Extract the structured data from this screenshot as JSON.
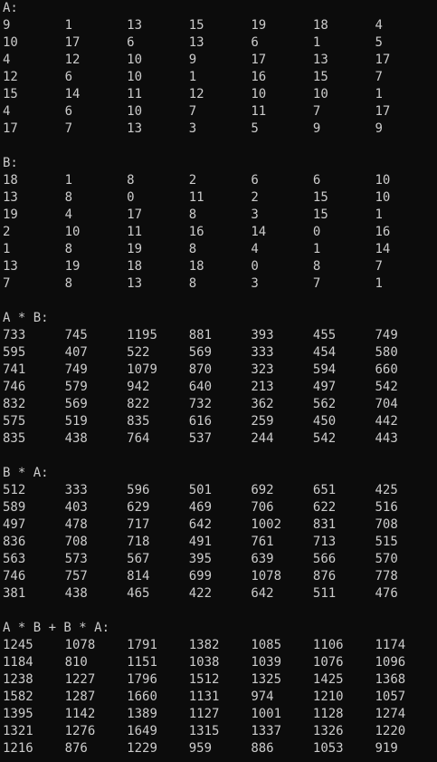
{
  "sections": [
    {
      "label": "A:",
      "rows": [
        [
          "9",
          "1",
          "13",
          "15",
          "19",
          "18",
          "4"
        ],
        [
          "10",
          "17",
          "6",
          "13",
          "6",
          "1",
          "5"
        ],
        [
          "4",
          "12",
          "10",
          "9",
          "17",
          "13",
          "17"
        ],
        [
          "12",
          "6",
          "10",
          "1",
          "16",
          "15",
          "7"
        ],
        [
          "15",
          "14",
          "11",
          "12",
          "10",
          "10",
          "1"
        ],
        [
          "4",
          "6",
          "10",
          "7",
          "11",
          "7",
          "17"
        ],
        [
          "17",
          "7",
          "13",
          "3",
          "5",
          "9",
          "9"
        ]
      ]
    },
    {
      "label": "B:",
      "rows": [
        [
          "18",
          "1",
          "8",
          "2",
          "6",
          "6",
          "10"
        ],
        [
          "13",
          "8",
          "0",
          "11",
          "2",
          "15",
          "10"
        ],
        [
          "19",
          "4",
          "17",
          "8",
          "3",
          "15",
          "1"
        ],
        [
          "2",
          "10",
          "11",
          "16",
          "14",
          "0",
          "16"
        ],
        [
          "1",
          "8",
          "19",
          "8",
          "4",
          "1",
          "14"
        ],
        [
          "13",
          "19",
          "18",
          "18",
          "0",
          "8",
          "7"
        ],
        [
          "7",
          "8",
          "13",
          "8",
          "3",
          "7",
          "1"
        ]
      ]
    },
    {
      "label": "A * B:",
      "rows": [
        [
          "733",
          "745",
          "1195",
          "881",
          "393",
          "455",
          "749"
        ],
        [
          "595",
          "407",
          "522",
          "569",
          "333",
          "454",
          "580"
        ],
        [
          "741",
          "749",
          "1079",
          "870",
          "323",
          "594",
          "660"
        ],
        [
          "746",
          "579",
          "942",
          "640",
          "213",
          "497",
          "542"
        ],
        [
          "832",
          "569",
          "822",
          "732",
          "362",
          "562",
          "704"
        ],
        [
          "575",
          "519",
          "835",
          "616",
          "259",
          "450",
          "442"
        ],
        [
          "835",
          "438",
          "764",
          "537",
          "244",
          "542",
          "443"
        ]
      ]
    },
    {
      "label": "B * A:",
      "rows": [
        [
          "512",
          "333",
          "596",
          "501",
          "692",
          "651",
          "425"
        ],
        [
          "589",
          "403",
          "629",
          "469",
          "706",
          "622",
          "516"
        ],
        [
          "497",
          "478",
          "717",
          "642",
          "1002",
          "831",
          "708"
        ],
        [
          "836",
          "708",
          "718",
          "491",
          "761",
          "713",
          "515"
        ],
        [
          "563",
          "573",
          "567",
          "395",
          "639",
          "566",
          "570"
        ],
        [
          "746",
          "757",
          "814",
          "699",
          "1078",
          "876",
          "778"
        ],
        [
          "381",
          "438",
          "465",
          "422",
          "642",
          "511",
          "476"
        ]
      ]
    },
    {
      "label": "A * B + B * A:",
      "rows": [
        [
          "1245",
          "1078",
          "1791",
          "1382",
          "1085",
          "1106",
          "1174"
        ],
        [
          "1184",
          "810",
          "1151",
          "1038",
          "1039",
          "1076",
          "1096"
        ],
        [
          "1238",
          "1227",
          "1796",
          "1512",
          "1325",
          "1425",
          "1368"
        ],
        [
          "1582",
          "1287",
          "1660",
          "1131",
          "974",
          "1210",
          "1057"
        ],
        [
          "1395",
          "1142",
          "1389",
          "1127",
          "1001",
          "1128",
          "1274"
        ],
        [
          "1321",
          "1276",
          "1649",
          "1315",
          "1337",
          "1326",
          "1220"
        ],
        [
          "1216",
          "876",
          "1229",
          "959",
          "886",
          "1053",
          "919"
        ]
      ]
    }
  ]
}
